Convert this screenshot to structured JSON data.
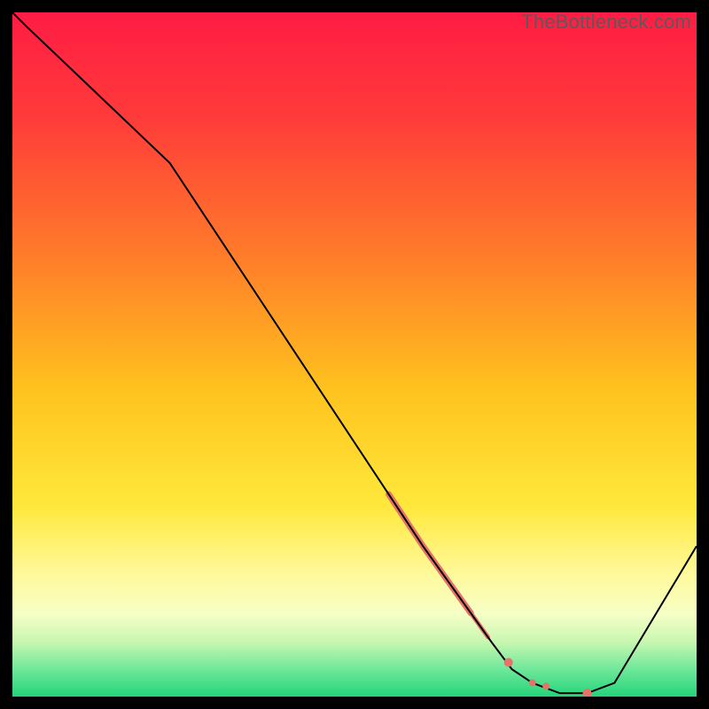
{
  "watermark": "TheBottleneck.com",
  "chart_data": {
    "type": "line",
    "title": "",
    "xlabel": "",
    "ylabel": "",
    "xlim": [
      0,
      100
    ],
    "ylim": [
      0,
      100
    ],
    "grid": false,
    "x": [
      0,
      2,
      23,
      60,
      70,
      73,
      76,
      80,
      84,
      88,
      100
    ],
    "values": [
      100,
      98,
      78,
      22,
      8,
      4,
      2,
      0.5,
      0.5,
      2,
      22
    ],
    "highlight_segments": [
      {
        "x0": 55,
        "x1": 67,
        "thickness": 7
      },
      {
        "x0": 67,
        "x1": 69.5,
        "thickness": 5
      }
    ],
    "highlight_points": [
      {
        "x": 72.5,
        "y": 5,
        "r": 5
      },
      {
        "x": 76,
        "y": 2,
        "r": 4
      },
      {
        "x": 78,
        "y": 1.5,
        "r": 4
      },
      {
        "x": 84,
        "y": 0.5,
        "r": 5
      }
    ],
    "gradient_stops": [
      {
        "offset": 0.0,
        "color": "#ff1c44"
      },
      {
        "offset": 0.15,
        "color": "#ff3a3a"
      },
      {
        "offset": 0.35,
        "color": "#ff7a2a"
      },
      {
        "offset": 0.55,
        "color": "#ffc21e"
      },
      {
        "offset": 0.72,
        "color": "#ffe83a"
      },
      {
        "offset": 0.82,
        "color": "#fff99a"
      },
      {
        "offset": 0.88,
        "color": "#f6ffc6"
      },
      {
        "offset": 0.92,
        "color": "#c8f7b0"
      },
      {
        "offset": 0.96,
        "color": "#6fe89a"
      },
      {
        "offset": 1.0,
        "color": "#24d47a"
      }
    ],
    "line_color": "#000000",
    "highlight_color": "#e8726a"
  }
}
